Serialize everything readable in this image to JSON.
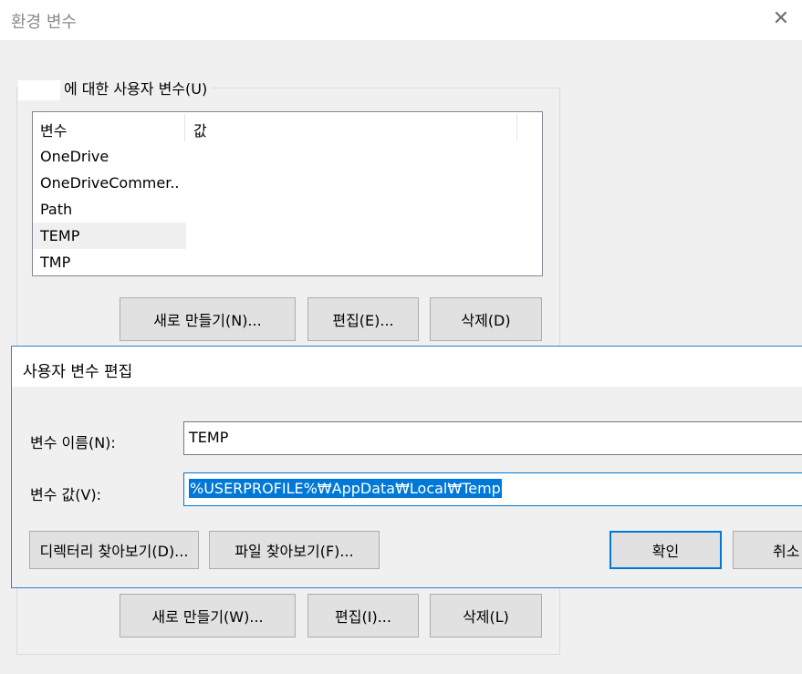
{
  "env_window": {
    "title": "환경 변수",
    "close_glyph": "✕",
    "user_group_label": "에 대한 사용자 변수(U)",
    "list_headers": {
      "name": "변수",
      "value": "값"
    },
    "user_vars": [
      {
        "name": "OneDrive"
      },
      {
        "name": "OneDriveCommer.."
      },
      {
        "name": "Path"
      },
      {
        "name": "TEMP"
      },
      {
        "name": "TMP"
      }
    ],
    "user_buttons": {
      "new": "새로 만들기(N)...",
      "edit": "편집(E)...",
      "delete": "삭제(D)"
    },
    "system_buttons": {
      "new": "새로 만들기(W)...",
      "edit": "편집(I)...",
      "delete": "삭제(L)"
    }
  },
  "edit_dialog": {
    "title": "사용자 변수 편집",
    "name_label": "변수 이름(N):",
    "name_value": "TEMP",
    "value_label": "변수 값(V):",
    "value_value": "%USERPROFILE%₩AppData₩Local₩Temp",
    "browse_dir": "디렉터리 찾아보기(D)...",
    "browse_file": "파일 찾아보기(F)...",
    "ok": "확인",
    "cancel": "취소"
  },
  "colors": {
    "accent": "#0078d7",
    "dialog_border": "#2f7fd4",
    "window_bg": "#f0f0f0",
    "button_bg": "#e1e1e1"
  }
}
